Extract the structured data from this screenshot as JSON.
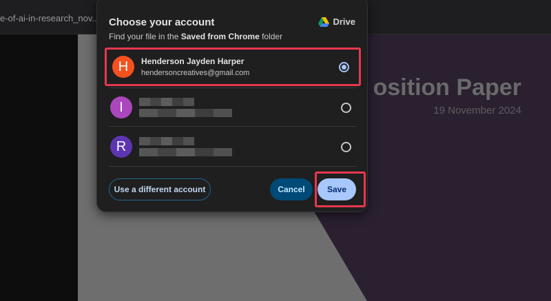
{
  "tab": {
    "title": "e-of-ai-in-research_nov..."
  },
  "document": {
    "title": "osition Paper",
    "date": "19 November 2024"
  },
  "dialog": {
    "title": "Choose your account",
    "subtitle_prefix": "Find your file in the ",
    "subtitle_folder": "Saved from Chrome",
    "subtitle_suffix": " folder",
    "brand": "Drive",
    "accounts": [
      {
        "initial": "H",
        "name": "Henderson Jayden Harper",
        "email": "hendersoncreatives@gmail.com",
        "color": "#f4511e",
        "selected": true
      },
      {
        "initial": "I",
        "color": "#ab47bc",
        "selected": false
      },
      {
        "initial": "R",
        "color": "#5e35b1",
        "selected": false
      }
    ],
    "use_different": "Use a different account",
    "cancel": "Cancel",
    "save": "Save"
  }
}
